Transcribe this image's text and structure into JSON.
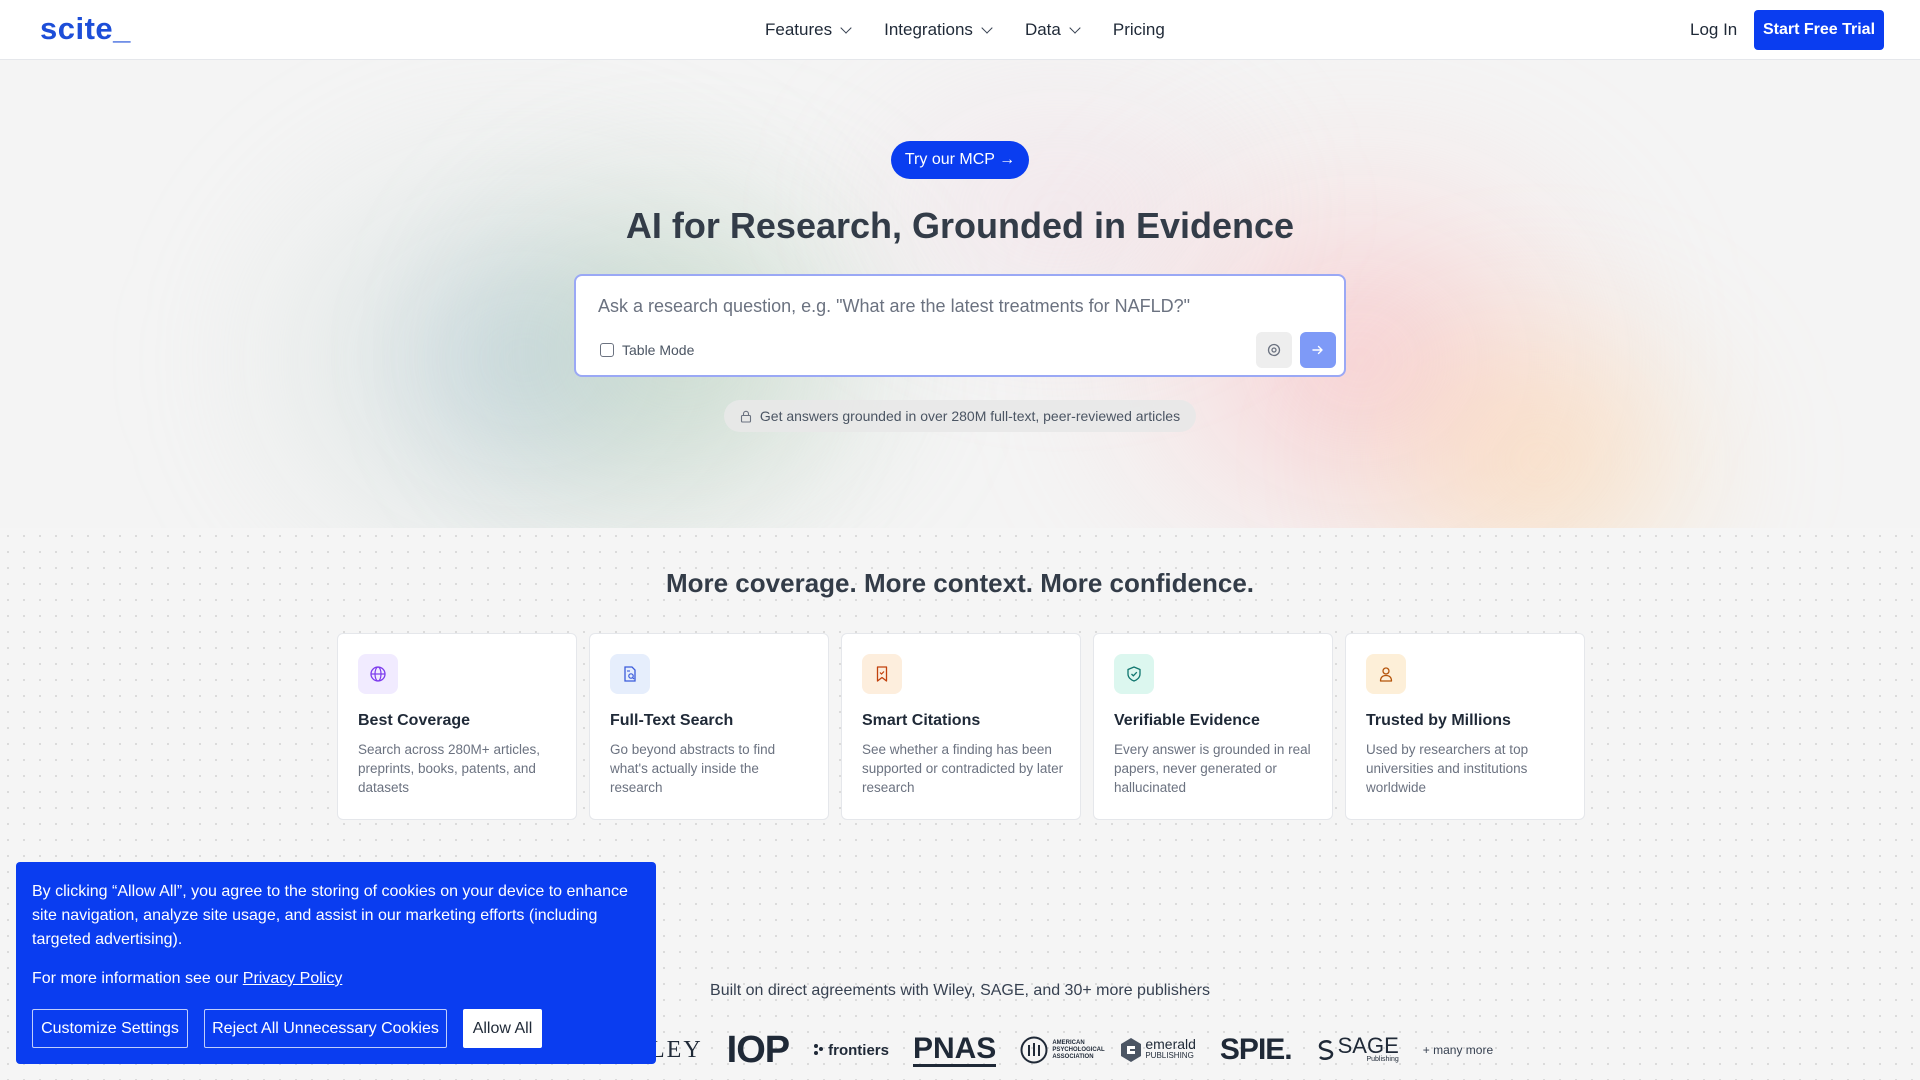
{
  "nav": {
    "logo": "scite_",
    "menu": [
      {
        "label": "Features"
      },
      {
        "label": "Integrations"
      },
      {
        "label": "Data"
      },
      {
        "label": "Pricing"
      }
    ],
    "login": "Log In",
    "cta": "Start Free Trial"
  },
  "hero": {
    "mcp_label": "Try our MCP →",
    "headline": "AI for Research, Grounded in Evidence",
    "search_placeholder": "Ask a research question, e.g. \"What are the latest treatments for NAFLD?\"",
    "table_mode_label": "Table Mode",
    "table_mode_checked": false,
    "grounded_note": "Get answers grounded in over 280M full-text, peer-reviewed articles"
  },
  "features": {
    "title": "More coverage. More context. More confidence.",
    "cards": [
      {
        "icon": "globe-icon",
        "title": "Best Coverage",
        "desc": "Search across 280M+ articles, preprints, books, patents, and datasets",
        "icon_bg": "#f1ebff",
        "icon_color": "#7c3aed"
      },
      {
        "icon": "document-search-icon",
        "title": "Full-Text Search",
        "desc": "Go beyond abstracts to find what's actually inside the research",
        "icon_bg": "#e6eefc",
        "icon_color": "#3b5bdb"
      },
      {
        "icon": "bookmark-icon",
        "title": "Smart Citations",
        "desc": "See whether a finding has been supported or contradicted by later research",
        "icon_bg": "#fdeedd",
        "icon_color": "#c2410c"
      },
      {
        "icon": "shield-check-icon",
        "title": "Verifiable Evidence",
        "desc": "Every answer is grounded in real papers, never generated or hallucinated",
        "icon_bg": "#dcf7ef",
        "icon_color": "#0f766e"
      },
      {
        "icon": "user-icon",
        "title": "Trusted by Millions",
        "desc": "Used by researchers at top universities and institutions worldwide",
        "icon_bg": "#fdefd8",
        "icon_color": "#b45309"
      }
    ],
    "publishers_text": "Built on direct agreements with Wiley, SAGE, and 30+ more publishers",
    "logos": {
      "wiley": "LEY",
      "iop": "IOP",
      "frontiers": "frontiers",
      "pnas": "PNAS",
      "apa": "AMERICAN PSYCHOLOGICAL ASSOCIATION",
      "emerald_1": "emerald",
      "emerald_2": "PUBLISHING",
      "spie": "SPIE.",
      "sage": "SAGE",
      "sage_sub": "Publishing",
      "more": "+ many more"
    }
  },
  "cookie": {
    "text": "By clicking “Allow All”, you agree to the storing of cookies on your device to enhance site navigation, analyze site usage, and assist in our marketing efforts (including targeted advertising).",
    "more_prefix": "For more information see our",
    "privacy_link": "Privacy Policy",
    "customize": "Customize Settings",
    "reject": "Reject All Unnecessary Cookies",
    "allow": "Allow All"
  },
  "colors": {
    "brand": "#0a3df0",
    "send_button": "#7e9af7"
  }
}
